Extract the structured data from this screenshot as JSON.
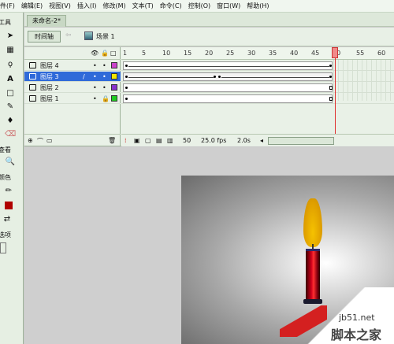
{
  "menubar": {
    "items": [
      "件(F)",
      "编辑(E)",
      "视图(V)",
      "插入(I)",
      "修改(M)",
      "文本(T)",
      "命令(C)",
      "控制(O)",
      "窗口(W)",
      "帮助(H)"
    ]
  },
  "toolbox": {
    "tools_label": "工具",
    "view_label": "查看",
    "colors_label": "颜色",
    "options_label": "选项"
  },
  "document": {
    "tab_title": "未命名-2*"
  },
  "editbar": {
    "timeline_button": "时间轴",
    "scene_label": "场景 1"
  },
  "timeline": {
    "ruler_labels": [
      "1",
      "5",
      "10",
      "15",
      "20",
      "25",
      "30",
      "35",
      "40",
      "45",
      "50",
      "55",
      "60"
    ],
    "layers": [
      {
        "name": "图层 4",
        "color": "#cc44cc",
        "selected": false,
        "locked": false
      },
      {
        "name": "图层 3",
        "color": "#f2e600",
        "selected": true,
        "locked": false
      },
      {
        "name": "图层 2",
        "color": "#8833cc",
        "selected": false,
        "locked": false
      },
      {
        "name": "图层 1",
        "color": "#22cc22",
        "selected": false,
        "locked": true
      }
    ],
    "current_frame": "50",
    "frame_rate": "25.0 fps",
    "elapsed_time": "2.0s"
  },
  "watermark": {
    "url": "jb51.net",
    "name": "脚本之家"
  }
}
